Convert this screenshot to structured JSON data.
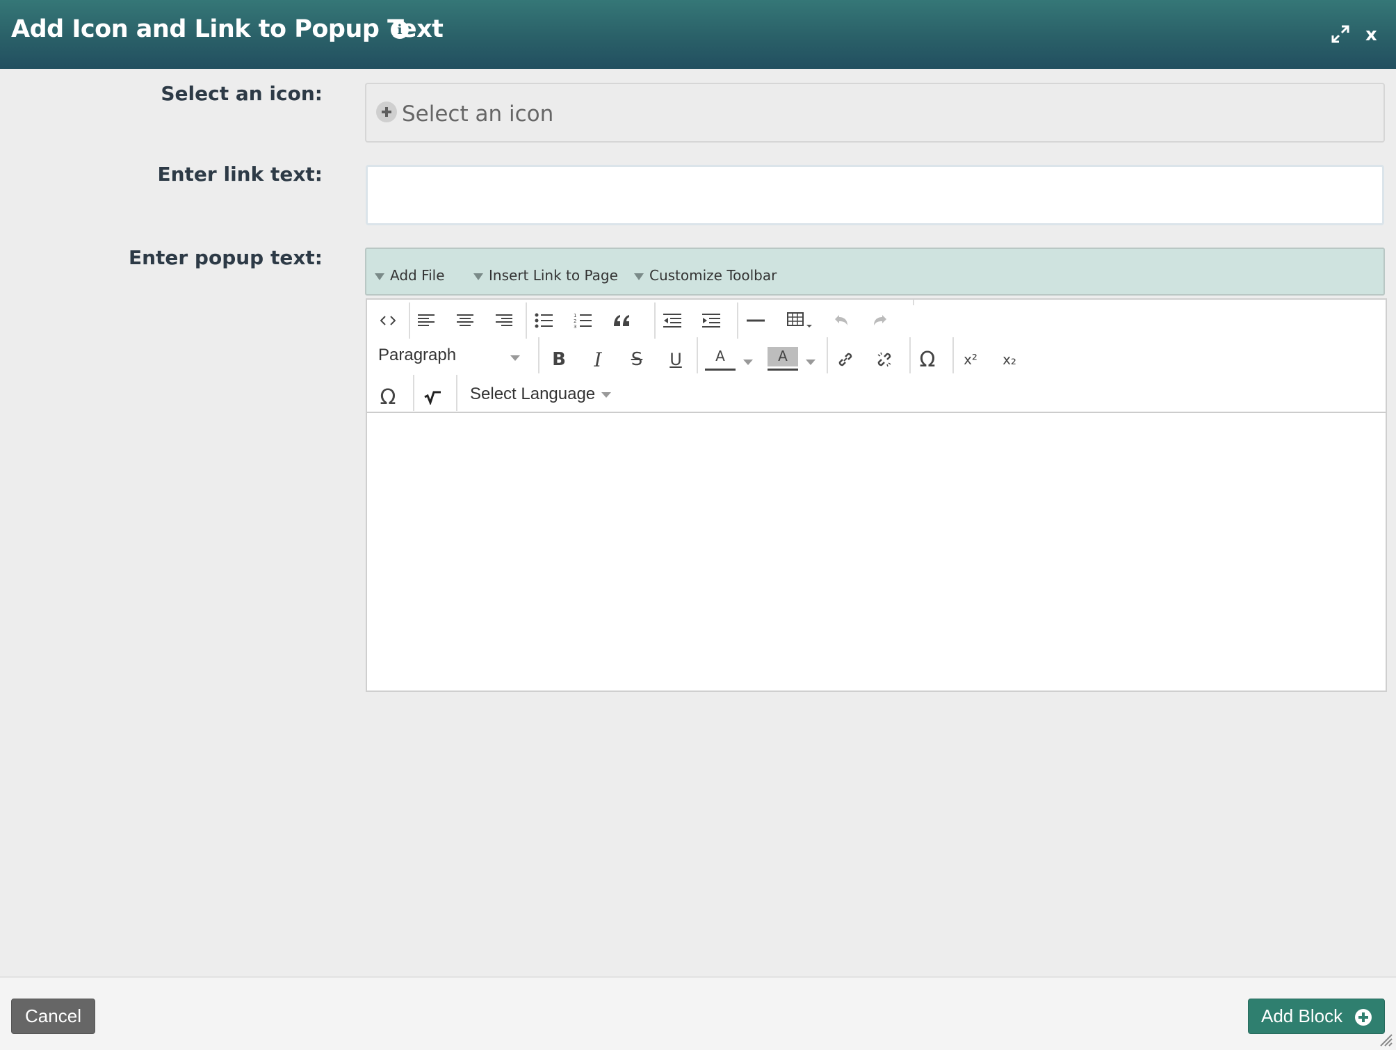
{
  "dialog": {
    "title": "Add Icon and Link to Popup Text",
    "info_icon": "info-icon",
    "expand_icon": "expand-icon",
    "close_label": "x"
  },
  "form": {
    "icon_label": "Select an icon:",
    "icon_placeholder": "Select an icon",
    "link_label": "Enter link text:",
    "link_value": "",
    "popup_label": "Enter popup text:"
  },
  "plugin_bar": {
    "add_file": "Add File",
    "insert_link": "Insert Link to Page",
    "customize": "Customize Toolbar"
  },
  "toolbar": {
    "paragraph": "Paragraph",
    "language": "Select Language",
    "row1_icons": [
      "code-icon",
      "align-left-icon",
      "align-center-icon",
      "align-right-icon",
      "bullet-list-icon",
      "numbered-list-icon",
      "blockquote-icon",
      "outdent-icon",
      "indent-icon",
      "horizontal-rule-icon",
      "table-icon",
      "undo-icon",
      "redo-icon"
    ],
    "row2_icons": [
      "bold-icon",
      "italic-icon",
      "strikethrough-icon",
      "underline-icon",
      "text-color-icon",
      "background-color-icon",
      "link-icon",
      "unlink-icon",
      "special-character-icon",
      "superscript-icon",
      "subscript-icon"
    ],
    "row3_icons": [
      "omega-icon",
      "math-icon"
    ],
    "glyphs": {
      "bold": "B",
      "italic": "I",
      "underline": "U",
      "strike": "S",
      "text_color": "A",
      "bg_color": "A",
      "omega": "Ω",
      "super": "x²",
      "sub": "x₂"
    }
  },
  "footer": {
    "cancel": "Cancel",
    "add_block": "Add Block"
  }
}
